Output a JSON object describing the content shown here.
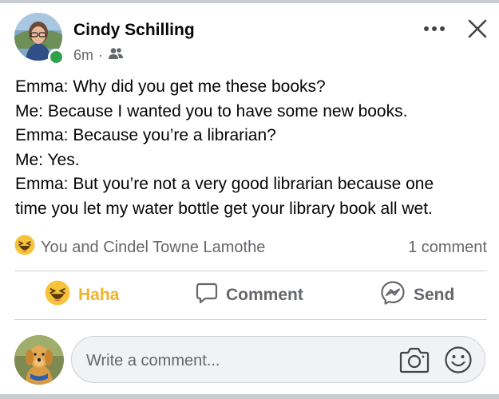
{
  "post": {
    "author": "Cindy Schilling",
    "time": "6m",
    "separator": "·",
    "audience_icon": "friends-icon",
    "lines": [
      "Emma: Why did you get me these books?",
      "Me: Because I wanted you to have some new books.",
      "Emma: Because you’re a librarian?",
      "Me: Yes.",
      "Emma: But you’re not a very good librarian because one",
      "time you let my water bottle get your library book all wet."
    ]
  },
  "reactions": {
    "icon": "haha-reaction-icon",
    "text": "You and Cindel Towne Lamothe",
    "comments": "1 comment"
  },
  "actions": {
    "haha": "Haha",
    "comment": "Comment",
    "send": "Send"
  },
  "composer": {
    "placeholder": "Write a comment..."
  },
  "colors": {
    "haha_active": "#f0b42b",
    "online": "#31a24c",
    "secondary_text": "#65676b"
  }
}
